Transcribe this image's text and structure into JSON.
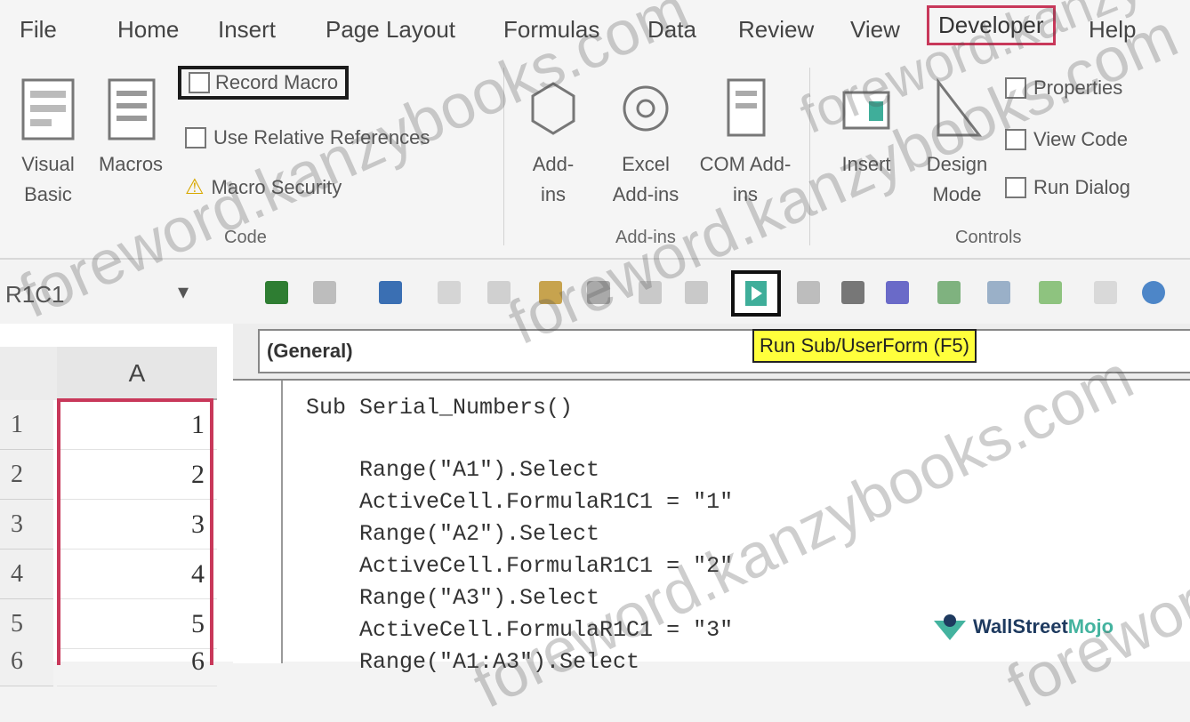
{
  "menu": {
    "tabs": [
      {
        "label": "File"
      },
      {
        "label": "Home"
      },
      {
        "label": "Insert"
      },
      {
        "label": "Page Layout"
      },
      {
        "label": "Formulas"
      },
      {
        "label": "Data"
      },
      {
        "label": "Review"
      },
      {
        "label": "View"
      },
      {
        "label": "Developer",
        "active": true
      },
      {
        "label": "Help"
      }
    ]
  },
  "ribbon": {
    "code_group": {
      "label": "Code",
      "visual_basic": "Visual Basic",
      "macros": "Macros",
      "record_macro": "Record Macro",
      "use_relative": "Use Relative References",
      "macro_security": "Macro Security"
    },
    "addins_group": {
      "label": "Add-ins",
      "addins": "Add-ins",
      "excel_addins": "Excel Add-ins",
      "com_addins": "COM Add-ins"
    },
    "controls_group": {
      "label": "Controls",
      "insert": "Insert",
      "design_mode": "Design Mode",
      "properties": "Properties",
      "view_code": "View Code",
      "run_dialog": "Run Dialog"
    }
  },
  "toolbar": {
    "name_box": "R1C1",
    "tooltip": "Run Sub/UserForm (F5)"
  },
  "sheet": {
    "column_header": "A",
    "rows": [
      {
        "num": "1",
        "value": "1"
      },
      {
        "num": "2",
        "value": "2"
      },
      {
        "num": "3",
        "value": "3"
      },
      {
        "num": "4",
        "value": "4"
      },
      {
        "num": "5",
        "value": "5"
      },
      {
        "num": "6",
        "value": "6"
      }
    ]
  },
  "editor": {
    "dropdown": "(General)",
    "code_lines": [
      "Sub Serial_Numbers()",
      "",
      "    Range(\"A1\").Select",
      "    ActiveCell.FormulaR1C1 = \"1\"",
      "    Range(\"A2\").Select",
      "    ActiveCell.FormulaR1C1 = \"2\"",
      "    Range(\"A3\").Select",
      "    ActiveCell.FormulaR1C1 = \"3\"",
      "    Range(\"A1:A3\").Select"
    ]
  },
  "logo": {
    "brand_main": "WallStreet",
    "brand_hl": "Mojo"
  },
  "watermarks": [
    "foreword.kanzybooks.com",
    "foreword.kanzybooks.com",
    "foreword.kanzybooks.com",
    "foreword.kanzybooks.com",
    "foreword.kanzybooks.com"
  ],
  "colors": {
    "highlight_border": "#c8385a",
    "tooltip_bg": "#ffff3c",
    "run_icon": "#3fae9a"
  }
}
